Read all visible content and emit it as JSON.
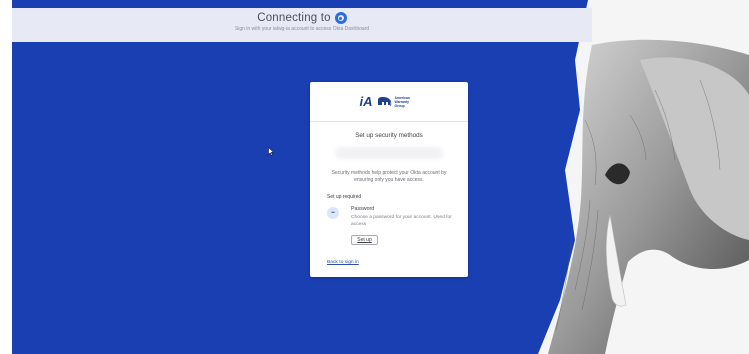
{
  "top_band": {
    "title": "Connecting to",
    "subtitle": "Sign in with your ialwg-ia account to access Okta Dashboard"
  },
  "card": {
    "logo": {
      "mark": "iA",
      "text": "American Warranty Group"
    },
    "heading": "Set up security methods",
    "description": "Security methods help protect your Okta account by ensuring only you have access.",
    "setup_required_label": "Set up required",
    "password": {
      "title": "Password",
      "description": "Choose a password for your account. Used for access",
      "button_label": "Set up"
    },
    "back_link": "Back to sign in"
  },
  "colors": {
    "background_blue": "#1a3fb3",
    "top_band": "#e7eaf4",
    "okta_blue": "#2b6de0",
    "link_blue": "#2a4fa8"
  },
  "icons": {
    "okta": "okta-logo-icon",
    "password": "password-icon",
    "cursor": "mouse-pointer-icon"
  }
}
